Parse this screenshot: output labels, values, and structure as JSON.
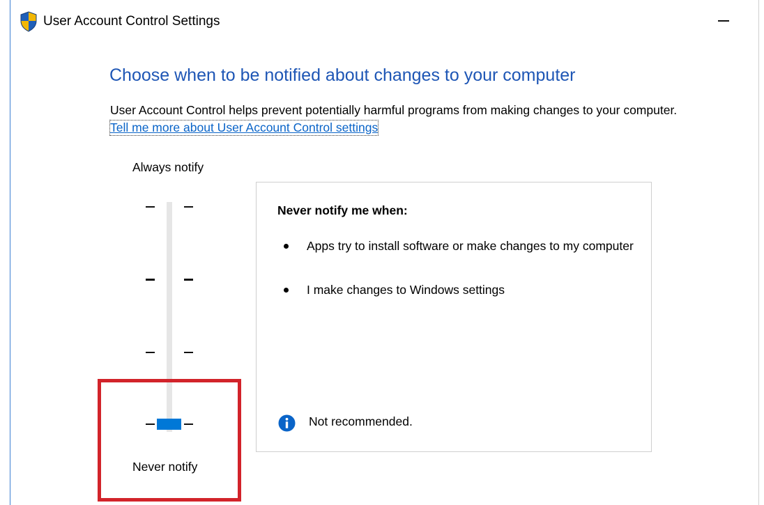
{
  "window": {
    "title": "User Account Control Settings",
    "icon": "uac-shield-icon",
    "controls": [
      "minimize"
    ]
  },
  "content": {
    "heading": "Choose when to be notified about changes to your computer",
    "description": "User Account Control helps prevent potentially harmful programs from making changes to your computer.",
    "learn_more_link": "Tell me more about User Account Control settings"
  },
  "slider": {
    "top_label": "Always notify",
    "bottom_label": "Never notify",
    "levels": 4,
    "selected_level": 1,
    "selected_level_name": "Never notify",
    "thumb_color": "#0078d7"
  },
  "panel": {
    "title": "Never notify me when:",
    "bullets": [
      "Apps try to install software or make changes to my computer",
      "I make changes to Windows settings"
    ],
    "note": "Not recommended.",
    "note_icon": "info-icon"
  },
  "colors": {
    "heading": "#1e56b5",
    "link": "#0a64c8",
    "accent": "#0078d7",
    "highlight_box": "#d2232a"
  },
  "annotation": {
    "highlight": "red box around never-notify slider position"
  }
}
